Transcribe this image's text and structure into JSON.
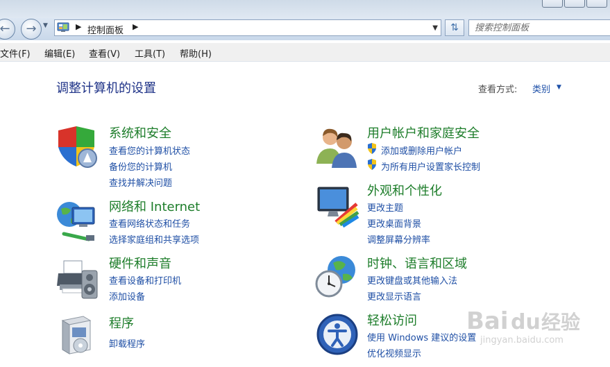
{
  "address": {
    "crumb": "控制面板"
  },
  "search": {
    "placeholder": "搜索控制面板"
  },
  "menu": [
    "文件(F)",
    "编辑(E)",
    "查看(V)",
    "工具(T)",
    "帮助(H)"
  ],
  "page_title": "调整计算机的设置",
  "view": {
    "label": "查看方式:",
    "value": "类别"
  },
  "categories": [
    {
      "title": "系统和安全",
      "icon": "shield-icon",
      "links": [
        "查看您的计算机状态",
        "备份您的计算机",
        "查找并解决问题"
      ]
    },
    {
      "title": "网络和 Internet",
      "icon": "network-globe-icon",
      "links": [
        "查看网络状态和任务",
        "选择家庭组和共享选项"
      ]
    },
    {
      "title": "硬件和声音",
      "icon": "printer-speaker-icon",
      "links": [
        "查看设备和打印机",
        "添加设备"
      ]
    },
    {
      "title": "程序",
      "icon": "programs-box-icon",
      "links": [
        "卸载程序"
      ]
    },
    {
      "title": "用户帐户和家庭安全",
      "icon": "users-icon",
      "links": [
        "添加或删除用户帐户",
        "为所有用户设置家长控制"
      ]
    },
    {
      "title": "外观和个性化",
      "icon": "monitor-colors-icon",
      "links": [
        "更改主题",
        "更改桌面背景",
        "调整屏幕分辨率"
      ]
    },
    {
      "title": "时钟、语言和区域",
      "icon": "clock-globe-icon",
      "links": [
        "更改键盘或其他输入法",
        "更改显示语言"
      ]
    },
    {
      "title": "轻松访问",
      "icon": "ease-of-access-icon",
      "links": [
        "使用 Windows 建议的设置",
        "优化视频显示"
      ]
    }
  ],
  "watermark": {
    "text": "Baidu经验",
    "url": "jingyan.baidu.com"
  },
  "colors": {
    "title": "#1e3287",
    "category": "#1d7d2a",
    "link": "#1f4fa5"
  }
}
